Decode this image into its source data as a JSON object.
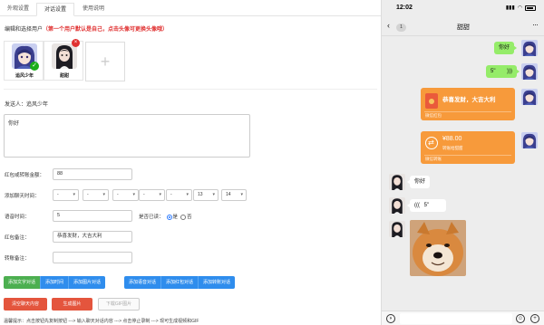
{
  "tabs": [
    {
      "label": "外观设置"
    },
    {
      "label": "对话设置"
    },
    {
      "label": "使用说明"
    }
  ],
  "users_hint": {
    "prefix": "编辑和选择用户",
    "note": "（第一个用户默认是自己，点击头像可更换头像哦）"
  },
  "users": [
    {
      "name": "追风少年"
    },
    {
      "name": "甜甜"
    }
  ],
  "add_user_symbol": "+",
  "sender": {
    "label": "发送人：",
    "name": "追风少年"
  },
  "message_text": "你好",
  "form": {
    "amount_label": "红包或转账金额：",
    "amount_value": "88",
    "add_time_label": "添加聊天时间：",
    "time_selects": [
      "-",
      "-",
      "-",
      "-",
      "-",
      "-"
    ],
    "hour_value": "13",
    "minute_value": "14",
    "voice_label": "语音时间：",
    "voice_value": "5",
    "read_label": "是否已读：",
    "read_yes": "是",
    "read_no": "否",
    "redpacket_note_label": "红包备注：",
    "redpacket_note_value": "恭喜发财，大吉大利",
    "transfer_note_label": "转账备注：",
    "transfer_note_value": ""
  },
  "buttons": {
    "add_text": "添加文字对话",
    "add_time": "添加时间",
    "add_image": "添加图片对话",
    "add_voice": "添加语音对话",
    "add_redpacket": "添加红包对话",
    "add_transfer": "添加转账对话",
    "clear": "清空聊天内容",
    "generate": "生成图片",
    "download": "下载GIF图片"
  },
  "tip": "温馨提示：点击按钮先复制按钮 ---> 输入聊天对话内容 ---> 点击停止录制 ---> 现可生成视频和GIF",
  "phone": {
    "time": "12:02",
    "back_count": "1",
    "chat_title": "甜甜",
    "more_icon": "···",
    "msg_hello": "你好",
    "msg_voice_sec": "5\"",
    "redpacket_text": "恭喜发财，大吉大利",
    "redpacket_label": "微信红包",
    "transfer_amount": "¥88.00",
    "transfer_sub": "转账给甜甜",
    "transfer_label": "微信转账",
    "reply_hello": "你好",
    "reply_voice_sec": "5\"",
    "colors": {
      "bubble_green": "#95ec69",
      "card_orange": "#f79a3b",
      "chat_bg": "#ededed"
    }
  },
  "icons": [
    "back-chevron-icon",
    "more-icon",
    "wifi-icon",
    "battery-icon",
    "voice-icon",
    "emoji-icon",
    "plus-icon",
    "check-icon",
    "close-icon",
    "redpacket-icon",
    "transfer-icon"
  ]
}
